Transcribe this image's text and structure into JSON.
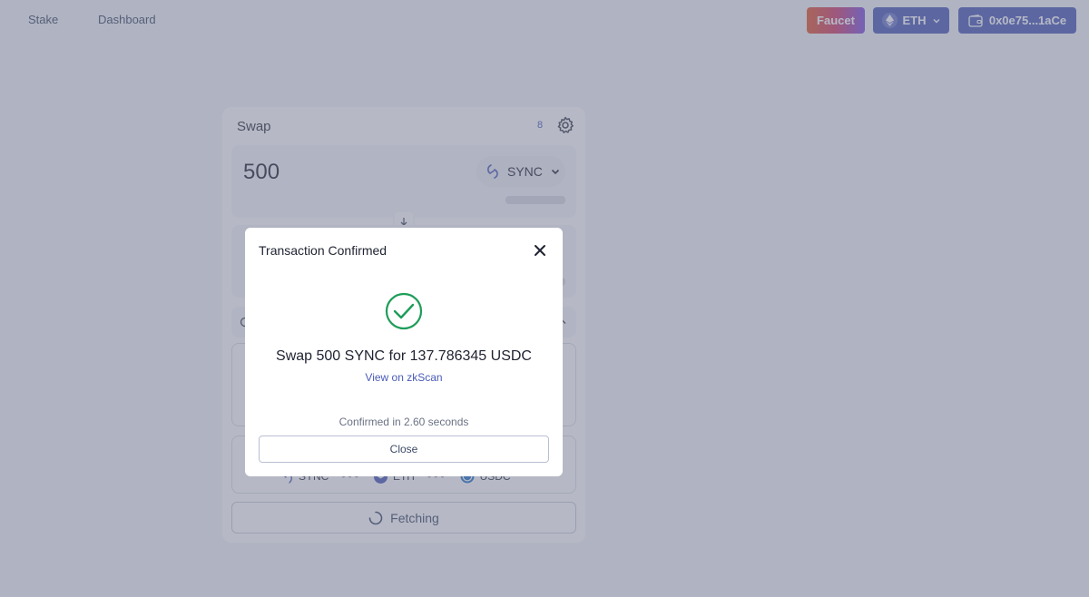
{
  "nav": {
    "links": [
      "Stake",
      "Dashboard"
    ],
    "faucet_label": "Faucet",
    "network_label": "ETH",
    "wallet_label": "0x0e75...1aCe"
  },
  "swap": {
    "title": "Swap",
    "slippage_badge": "8",
    "from_amount": "500",
    "from_token": "SYNC",
    "route_tokens": [
      "SYNC",
      "ETH",
      "USDC"
    ],
    "action_label": "Fetching"
  },
  "modal": {
    "title": "Transaction Confirmed",
    "message": "Swap 500 SYNC for 137.786345 USDC",
    "link_label": "View on zkScan",
    "confirmed_text": "Confirmed in 2.60 seconds",
    "close_label": "Close"
  },
  "colors": {
    "accent": "#4a5bb8",
    "success": "#1f9d5a",
    "overlay": "rgba(110,115,140,0.5)"
  },
  "icons": [
    "eth-icon",
    "chevron-down-icon",
    "wallet-icon",
    "gear-icon",
    "sync-token-icon",
    "arrow-down-icon",
    "spinner-icon",
    "close-icon",
    "check-circle-icon",
    "usdc-token-icon"
  ]
}
